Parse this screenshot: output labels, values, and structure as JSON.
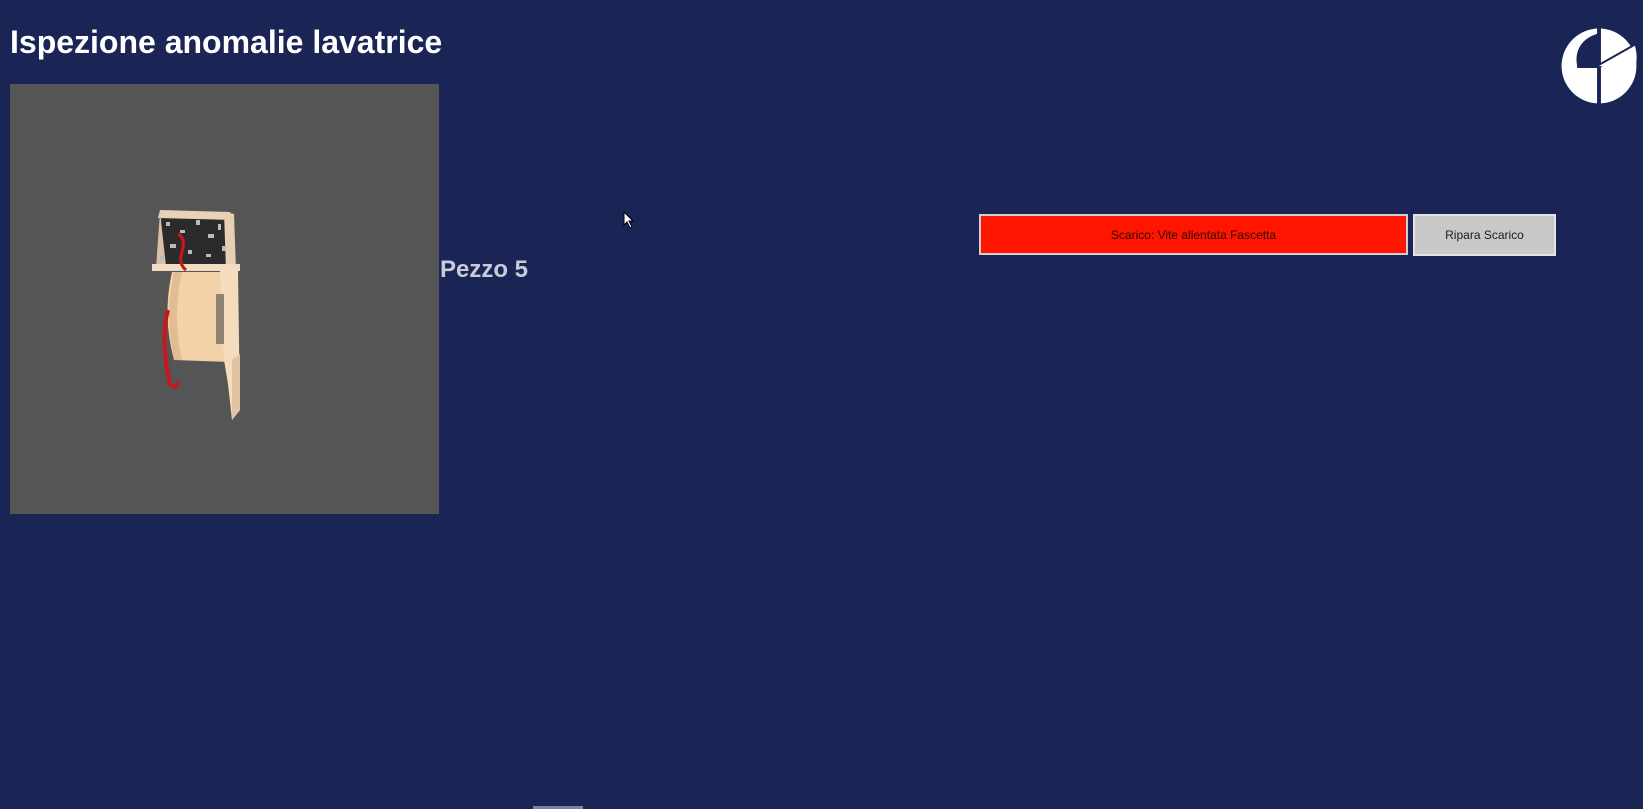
{
  "header": {
    "title": "Ispezione anomalie lavatrice"
  },
  "logo": {
    "icon": "brand-logo-icon"
  },
  "viewer": {
    "background": "#555555"
  },
  "piece": {
    "label": "Pezzo 5"
  },
  "anomaly": {
    "label": "Scarico: Vite allentata Fascetta",
    "color": "#ff1500"
  },
  "actions": {
    "repair_label": "Ripara Scarico"
  },
  "colors": {
    "background": "#1a2455",
    "button": "#c9c9c9"
  }
}
